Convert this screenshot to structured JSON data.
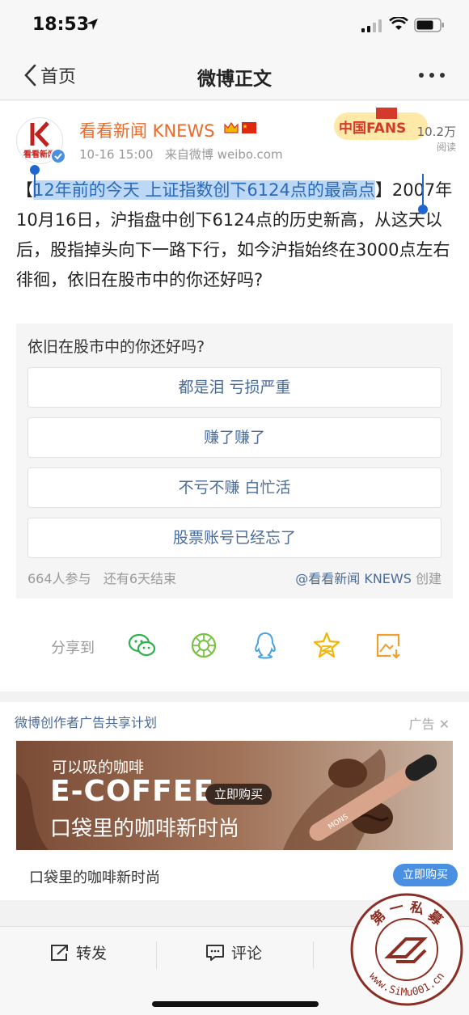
{
  "status_bar": {
    "time": "18:53"
  },
  "nav": {
    "back_label": "首页",
    "title": "微博正文"
  },
  "post": {
    "author": "看看新闻 KNEWS",
    "avatar_caption": "看看新闻",
    "timestamp": "10-16 15:00",
    "source": "来自微博 weibo.com",
    "fans_badge_text": "中国FANS",
    "read_count": "10.2万",
    "read_label": "阅读",
    "headline_open": "【",
    "headline_selected": "12年前的今天 上证指数创下6124点的最高点",
    "headline_close": "】",
    "body": "2007年10月16日，沪指盘中创下6124点的历史新高，从这天以后，股指掉头向下一路下行，如今沪指始终在3000点左右徘徊，依旧在股市中的你还好吗?"
  },
  "poll": {
    "question": "依旧在股市中的你还好吗?",
    "options": [
      "都是泪 亏损严重",
      "赚了赚了",
      "不亏不赚 白忙活",
      "股票账号已经忘了"
    ],
    "participants": "664人参与",
    "remaining": "还有6天结束",
    "creator": "@看看新闻 KNEWS",
    "created_label": "创建"
  },
  "share": {
    "label": "分享到",
    "icons": [
      "wechat-icon",
      "moments-icon",
      "qq-icon",
      "qzone-icon",
      "save-image-icon"
    ]
  },
  "ad": {
    "program_title": "微博创作者广告共享计划",
    "tag": "广告",
    "banner_line1": "可以吸的咖啡",
    "banner_brand": "E-COFFEE",
    "banner_cta": "立即购买",
    "banner_line3": "口袋里的咖啡新时尚",
    "product_logo": "MONS",
    "caption": "口袋里的咖啡新时尚",
    "button": "立即购买"
  },
  "toolbar": {
    "repost": "转发",
    "comment": "评论"
  },
  "watermark": {
    "chars": "第 一 私 募",
    "url": "www.SiMu001.cn"
  },
  "colors": {
    "accent_blue": "#4a90e2",
    "link_blue": "#4a6b99",
    "author_orange": "#e86b2b",
    "selection": "#bcd8f5"
  }
}
